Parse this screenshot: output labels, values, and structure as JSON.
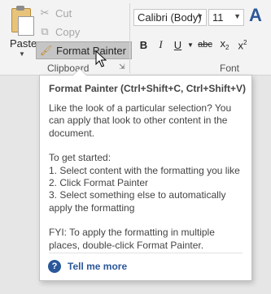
{
  "clipboard": {
    "paste_label": "Paste",
    "cut_label": "Cut",
    "copy_label": "Copy",
    "format_painter_label": "Format Painter",
    "group_label": "Clipboard"
  },
  "font": {
    "font_name": "Calibri (Body)",
    "font_size": "11",
    "group_label": "Font",
    "buttons": {
      "bold": "B",
      "italic": "I",
      "underline": "U",
      "strikethrough": "abc",
      "subscript": "x",
      "subscript_mark": "2",
      "superscript": "x",
      "superscript_mark": "2"
    },
    "grow_font_glyph": "A"
  },
  "tooltip": {
    "title": "Format Painter (Ctrl+Shift+C, Ctrl+Shift+V)",
    "paragraph1": "Like the look of a particular selection? You can apply that look to other content in the document.",
    "getting_started": "To get started:",
    "step1": "1. Select content with the formatting you like",
    "step2": "2. Click Format Painter",
    "step3": "3. Select something else to automatically apply the formatting",
    "fyi": "FYI: To apply the formatting in multiple places, double-click Format Painter.",
    "tell_me_more": "Tell me more"
  },
  "colors": {
    "accent": "#2b579a",
    "ribbon_bg": "#f3f3f3",
    "hover_bg": "#c5c5c5"
  },
  "icons": [
    "paste-icon",
    "cut-icon",
    "copy-icon",
    "format-painter-icon",
    "dialog-launcher-icon",
    "help-icon",
    "mouse-cursor-icon"
  ]
}
